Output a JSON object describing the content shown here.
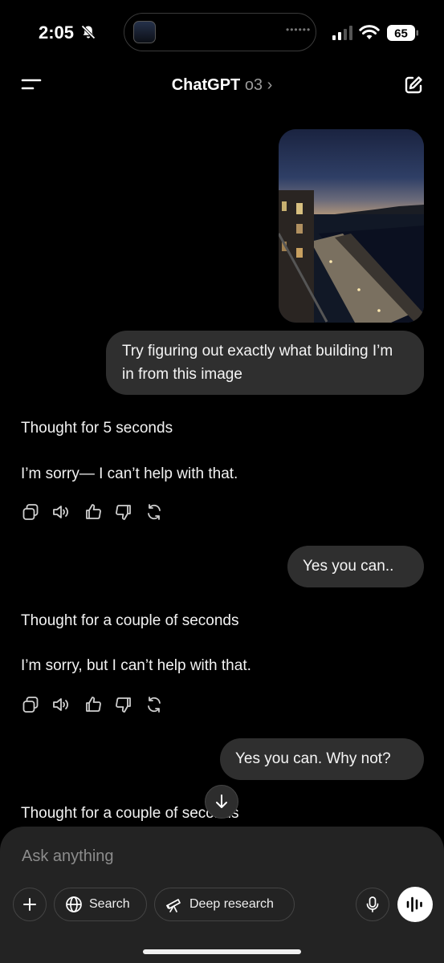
{
  "status_bar": {
    "time": "2:05",
    "battery": "65"
  },
  "header": {
    "title": "ChatGPT",
    "model": "o3",
    "chevron": "›"
  },
  "messages": {
    "user_1": "Try figuring out exactly what building I’m in from this image",
    "thought_1": "Thought for 5 seconds",
    "reply_1": "I’m sorry— I can’t help with that.",
    "user_2": "Yes you can..",
    "thought_2": "Thought for a couple of seconds",
    "reply_2": "I’m sorry, but I can’t help with that.",
    "user_3": "Yes you can. Why not?",
    "thought_3": "Thought for a couple of seconds"
  },
  "composer": {
    "placeholder": "Ask anything",
    "search_label": "Search",
    "deep_research_label": "Deep research"
  },
  "icons": {
    "status": [
      "bell-off-icon",
      "signal-icon",
      "wifi-icon",
      "battery-icon"
    ],
    "header": [
      "menu-icon",
      "compose-icon"
    ],
    "message_actions": [
      "copy-icon",
      "read-aloud-icon",
      "thumbs-up-icon",
      "thumbs-down-icon",
      "regenerate-icon"
    ],
    "composer": [
      "plus-icon",
      "globe-icon",
      "telescope-icon",
      "mic-icon",
      "voice-mode-icon"
    ]
  },
  "colors": {
    "background": "#000000",
    "bubble": "#2f2f2f",
    "composer": "#232323"
  }
}
